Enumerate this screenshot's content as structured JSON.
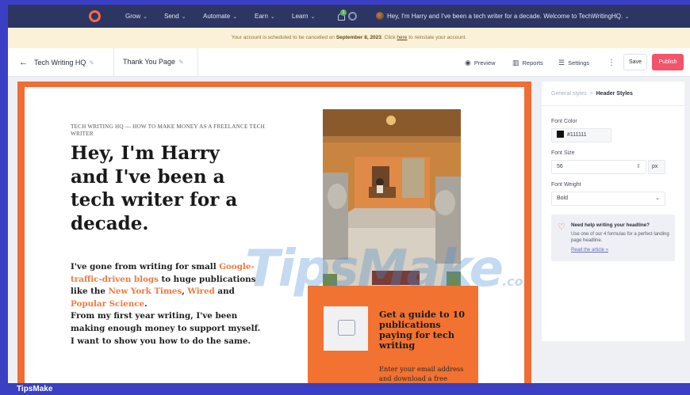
{
  "topnav": {
    "menu": [
      "Grow",
      "Send",
      "Automate",
      "Earn",
      "Learn"
    ],
    "notification_count": "1",
    "welcome": "Hey, I'm Harry and I've been a tech writer for a decade. Welcome to TechWritingHQ."
  },
  "notice": {
    "pre": "Your account is scheduled to be cancelled on ",
    "date": "September 8, 2023",
    "mid": ". Click ",
    "link": "here",
    "post": " to reinstate your account."
  },
  "toolbar": {
    "back": "←",
    "site_name": "Tech Writing HQ",
    "page_name": "Thank You Page",
    "preview": "Preview",
    "reports": "Reports",
    "settings": "Settings",
    "more": "⋮",
    "save": "Save",
    "publish": "Publish"
  },
  "page": {
    "kicker": "TECH WRITING HQ — HOW TO MAKE MONEY AS A FREELANCE TECH WRITER",
    "headline": "Hey, I'm Harry and I've been a tech writer for a decade.",
    "body": {
      "t1": "I've gone from writing for small ",
      "l1": "Google-traffic-driven blogs",
      "t2": " to huge publications like the ",
      "l2": "New York Times",
      "t3": ", ",
      "l3": "Wired",
      "t4": " and ",
      "l4": "Popular Science",
      "t5": ".",
      "t6": "From my first year writing, I've been making enough money to support myself. I want to show you how to do the same."
    },
    "optin": {
      "heading": "Get a guide to 10 publications paying for tech writing",
      "sub": "Enter your email address and download a free guide"
    }
  },
  "panel": {
    "crumb_parent": "General styles",
    "crumb_sep": ">",
    "crumb_current": "Header Styles",
    "font_color_label": "Font Color",
    "font_color_value": "#111111",
    "font_size_label": "Font Size",
    "font_size_value": "56",
    "font_size_unit": "px",
    "font_weight_label": "Font Weight",
    "font_weight_value": "Bold",
    "help_title": "Need help writing your headline?",
    "help_text": "Use one of our 4 formulas for a perfect landing page headline.",
    "help_link": "Read the article »"
  },
  "watermark": {
    "main": "TipsMake",
    "suffix": ".com"
  },
  "bottombar": {
    "label": "TipsMake"
  },
  "colors": {
    "accent": "#f06d33",
    "publish": "#f2556b",
    "nav_bg": "#2d3563",
    "frame": "#3a3fc4"
  }
}
